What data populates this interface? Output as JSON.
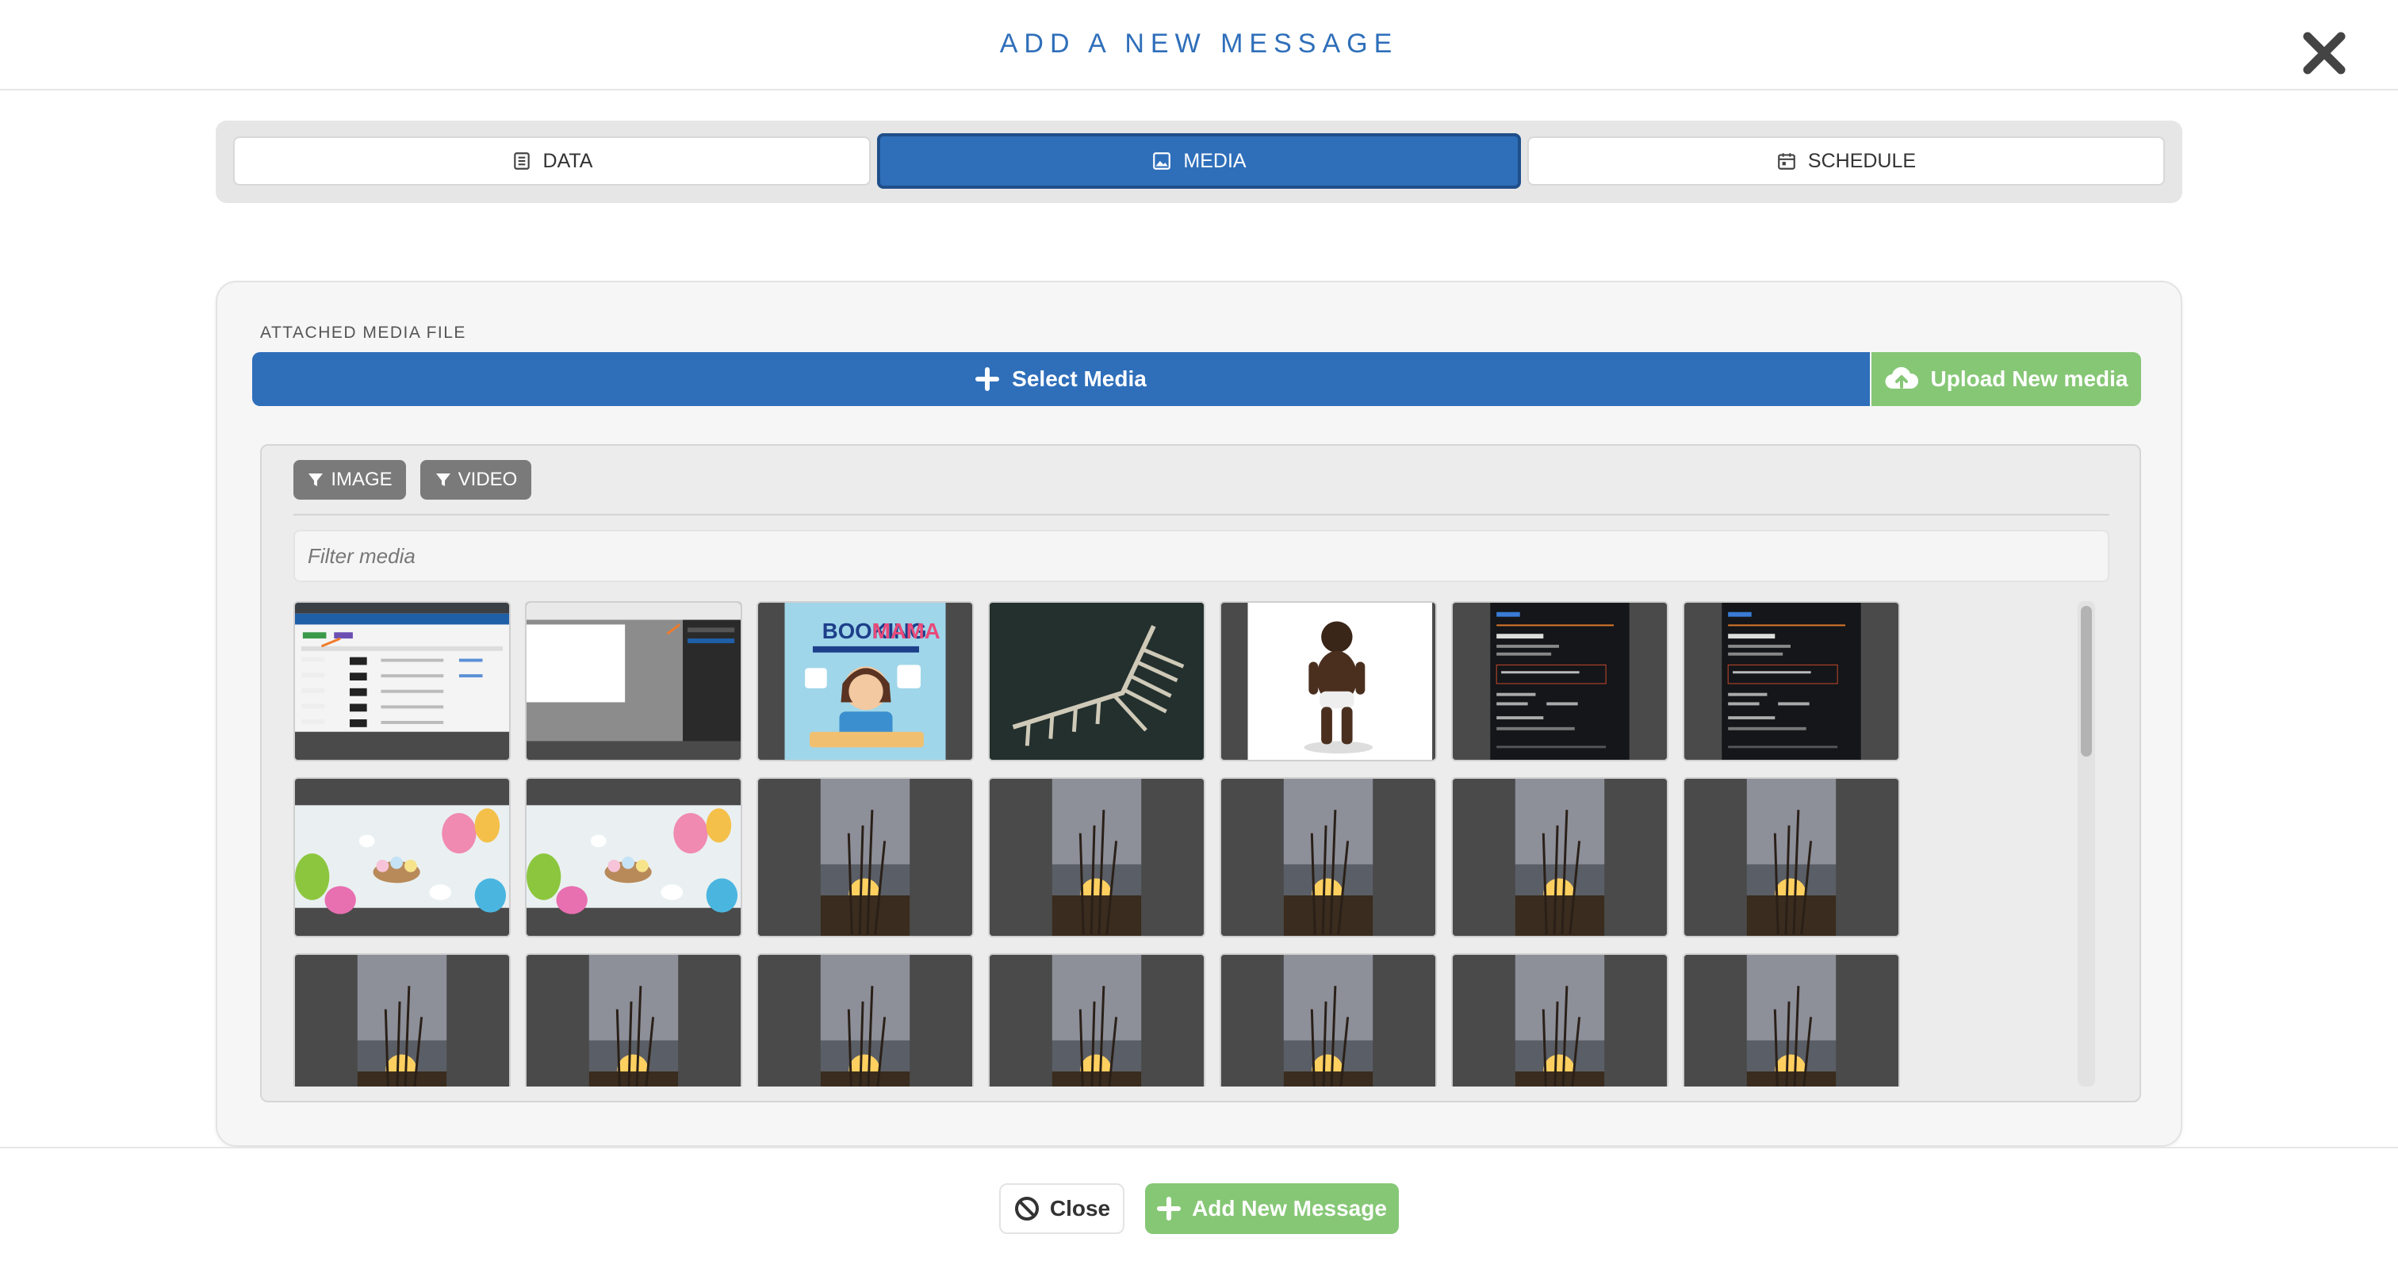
{
  "modal": {
    "title": "ADD A NEW MESSAGE",
    "close_icon": "close-x-icon"
  },
  "tabs": [
    {
      "label": "DATA",
      "icon": "document-icon",
      "active": false
    },
    {
      "label": "MEDIA",
      "icon": "image-icon",
      "active": true
    },
    {
      "label": "SCHEDULE",
      "icon": "calendar-icon",
      "active": false
    }
  ],
  "media_panel": {
    "section_label": "ATTACHED MEDIA FILE",
    "select_button_label": "Select Media",
    "upload_button_label": "Upload New media"
  },
  "library": {
    "filters": [
      {
        "label": "IMAGE",
        "icon": "filter-icon"
      },
      {
        "label": "VIDEO",
        "icon": "filter-icon"
      }
    ],
    "filter_placeholder": "Filter media",
    "thumbnails": [
      [
        "screenshot-table",
        "screenshot-dialog",
        "booking-mama-cartoon",
        "dock-aerial",
        "baby-figure",
        "dark-email",
        "dark-email"
      ],
      [
        "easter-eggs",
        "easter-eggs",
        "sunset-grass",
        "sunset-grass",
        "sunset-grass",
        "sunset-grass",
        "sunset-grass"
      ],
      [
        "sunset-grass",
        "sunset-grass",
        "sunset-grass",
        "sunset-grass",
        "sunset-grass",
        "sunset-grass",
        "sunset-grass"
      ]
    ],
    "booking_text_1": "BOOKING",
    "booking_text_2": "MAMA"
  },
  "footer": {
    "close_label": "Close",
    "add_label": "Add New Message"
  },
  "colors": {
    "primary": "#2f6fba",
    "success": "#86c776",
    "filter_button": "#7a7a7a"
  }
}
